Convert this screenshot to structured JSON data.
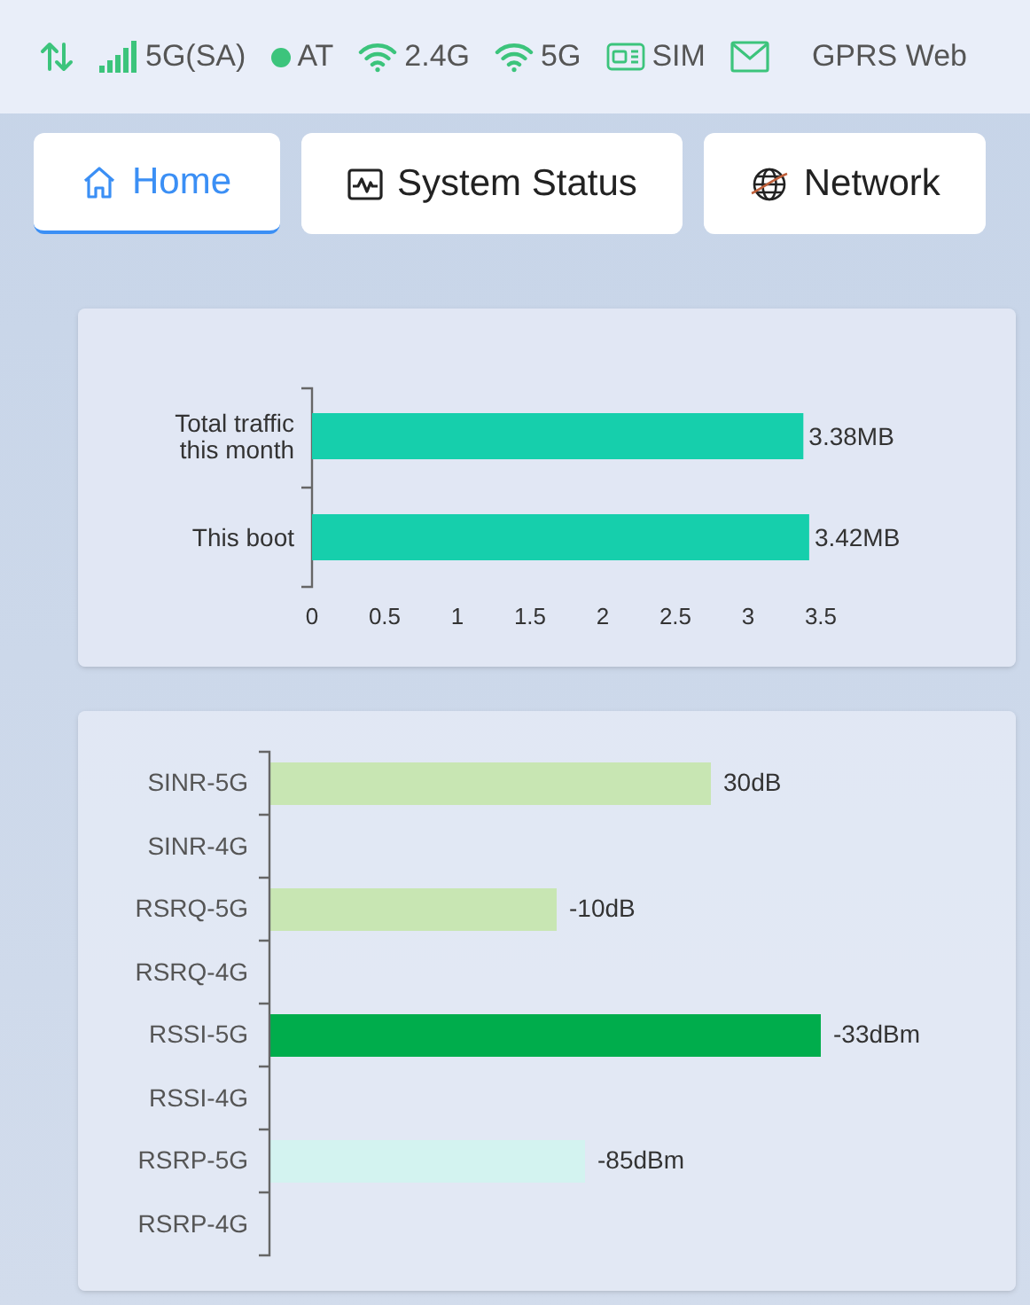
{
  "status_bar": [
    {
      "kind": "arrows"
    },
    {
      "kind": "signal",
      "text": "5G(SA)"
    },
    {
      "kind": "dot",
      "text": "AT"
    },
    {
      "kind": "wifi",
      "text": "2.4G"
    },
    {
      "kind": "wifi",
      "text": "5G"
    },
    {
      "kind": "sim",
      "text": "SIM"
    },
    {
      "kind": "mail"
    },
    {
      "kind": "plain",
      "text": "GPRS Web"
    }
  ],
  "tabs": [
    {
      "label": "Home",
      "kind": "home",
      "selected": true
    },
    {
      "label": "System Status",
      "kind": "pulse",
      "selected": false
    },
    {
      "label": "Network",
      "kind": "globe",
      "selected": false
    }
  ],
  "traffic": {
    "chart_data": {
      "type": "bar",
      "orientation": "horizontal",
      "categories": [
        "Total traffic this month",
        "This boot"
      ],
      "series": [
        {
          "color": "#16cfac",
          "values": [
            3.38,
            3.42
          ]
        }
      ],
      "xlim": [
        0,
        3.5
      ],
      "xticks": [
        0,
        {
          "value": 0.5,
          "label": "0.5"
        },
        1,
        {
          "value": 1.5,
          "label": "1.5"
        },
        2,
        {
          "value": 2.5,
          "label": "2.5"
        },
        3,
        {
          "value": 3.5,
          "label": "3.5"
        }
      ],
      "value_labels": [
        "3.38MB",
        "3.42MB"
      ]
    }
  },
  "signals": [
    {
      "label": "SINR-5G",
      "reading": "30dB",
      "color": "#c8e6b3"
    },
    {
      "label": "SINR-4G"
    },
    {
      "label": "RSRQ-5G",
      "reading": "-10dB",
      "color": "#c8e6b3"
    },
    {
      "label": "RSRQ-4G"
    },
    {
      "label": "RSSI-5G",
      "reading": "-33dBm",
      "color": "#00ad4c"
    },
    {
      "label": "RSSI-4G"
    },
    {
      "label": "RSRP-5G",
      "reading": "-85dBm",
      "color": "#d3f3f0"
    },
    {
      "label": "RSRP-4G"
    }
  ]
}
